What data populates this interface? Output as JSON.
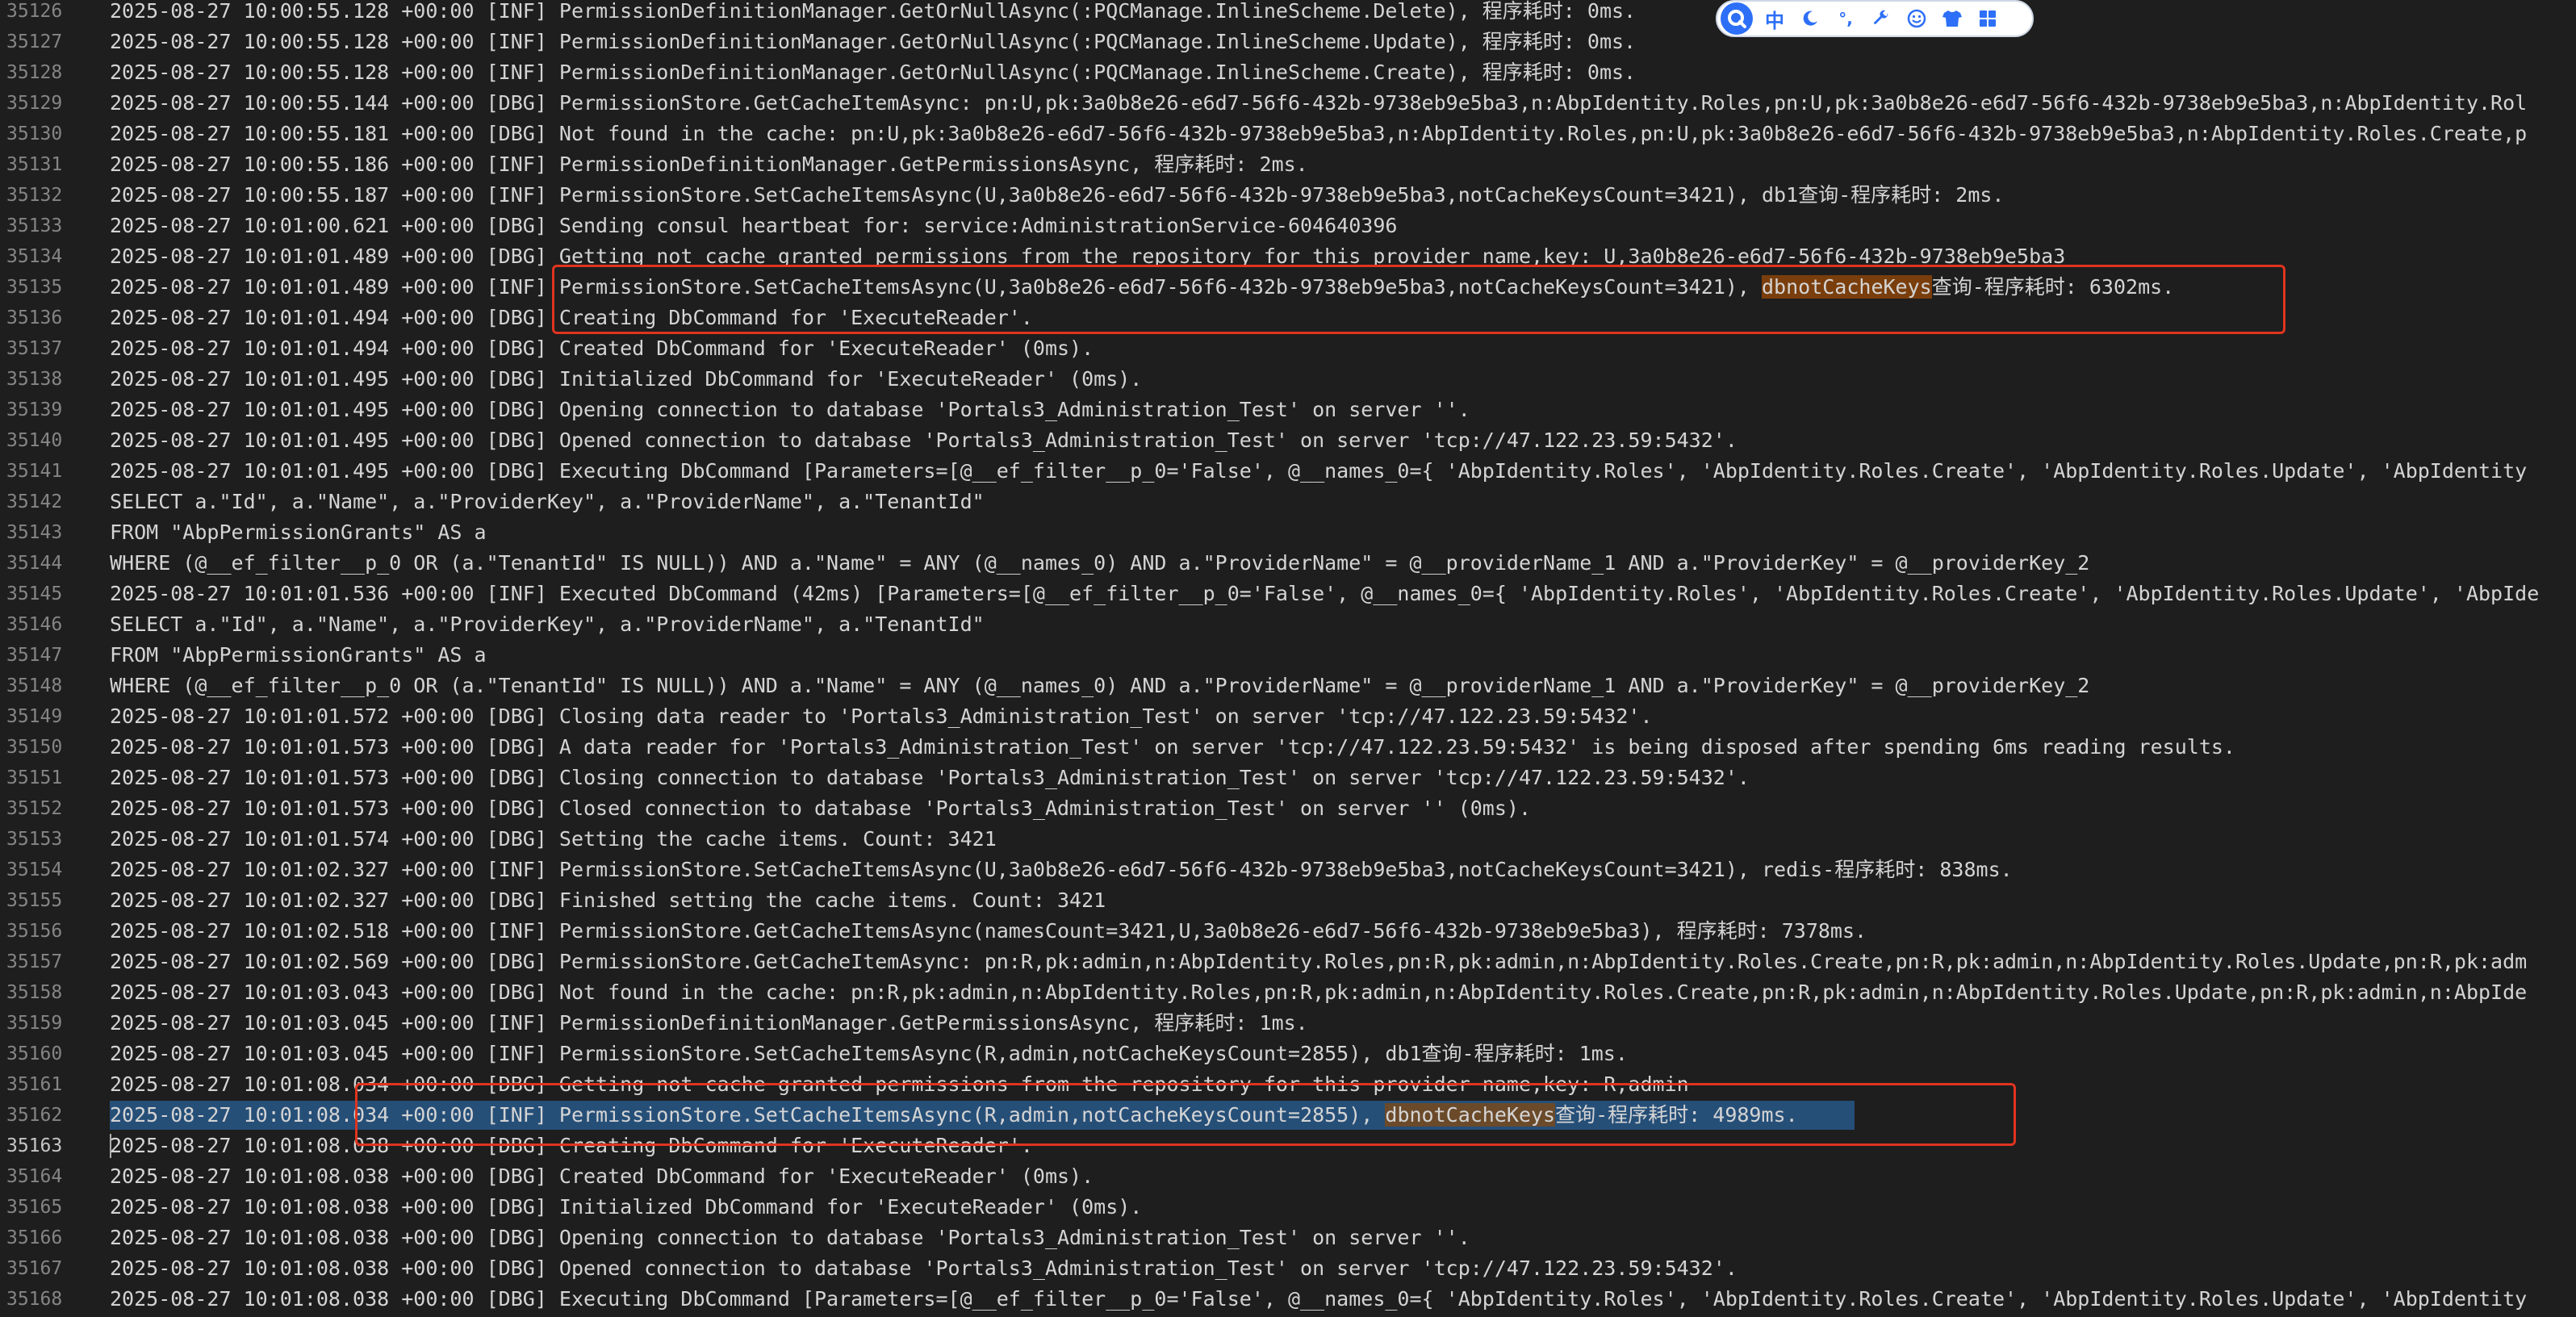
{
  "ime_toolbar": {
    "mode_label": "中",
    "punct_label": "°,",
    "icons": [
      "input-method-logo-icon",
      "moon-icon",
      "punctuation-icon",
      "wrench-icon",
      "smiley-icon",
      "shirt-icon",
      "grid-icon"
    ]
  },
  "colors": {
    "background": "#1e1e1e",
    "text": "#d4d4d4",
    "line_number": "#858585",
    "selection": "#264f78",
    "find_match": "#7a3e0c",
    "annotation_box": "#e0341f",
    "ime_accent": "#2d6ff7"
  },
  "highlighted_term": "dbnotCacheKeys",
  "current_line": "35163",
  "lines": [
    {
      "n": "35126",
      "text": "2025-08-27 10:00:55.128 +00:00 [INF] PermissionDefinitionManager.GetOrNullAsync(:PQCManage.InlineScheme.Delete), 程序耗时: 0ms."
    },
    {
      "n": "35127",
      "text": "2025-08-27 10:00:55.128 +00:00 [INF] PermissionDefinitionManager.GetOrNullAsync(:PQCManage.InlineScheme.Update), 程序耗时: 0ms."
    },
    {
      "n": "35128",
      "text": "2025-08-27 10:00:55.128 +00:00 [INF] PermissionDefinitionManager.GetOrNullAsync(:PQCManage.InlineScheme.Create), 程序耗时: 0ms."
    },
    {
      "n": "35129",
      "text": "2025-08-27 10:00:55.144 +00:00 [DBG] PermissionStore.GetCacheItemAsync: pn:U,pk:3a0b8e26-e6d7-56f6-432b-9738eb9e5ba3,n:AbpIdentity.Roles,pn:U,pk:3a0b8e26-e6d7-56f6-432b-9738eb9e5ba3,n:AbpIdentity.Rol"
    },
    {
      "n": "35130",
      "text": "2025-08-27 10:00:55.181 +00:00 [DBG] Not found in the cache: pn:U,pk:3a0b8e26-e6d7-56f6-432b-9738eb9e5ba3,n:AbpIdentity.Roles,pn:U,pk:3a0b8e26-e6d7-56f6-432b-9738eb9e5ba3,n:AbpIdentity.Roles.Create,p"
    },
    {
      "n": "35131",
      "text": "2025-08-27 10:00:55.186 +00:00 [INF] PermissionDefinitionManager.GetPermissionsAsync, 程序耗时: 2ms."
    },
    {
      "n": "35132",
      "text": "2025-08-27 10:00:55.187 +00:00 [INF] PermissionStore.SetCacheItemsAsync(U,3a0b8e26-e6d7-56f6-432b-9738eb9e5ba3,notCacheKeysCount=3421), db1查询-程序耗时: 2ms."
    },
    {
      "n": "35133",
      "text": "2025-08-27 10:01:00.621 +00:00 [DBG] Sending consul heartbeat for: service:AdministrationService-604640396"
    },
    {
      "n": "35134",
      "text": "2025-08-27 10:01:01.489 +00:00 [DBG] Getting not cache granted permissions from the repository for this provider name,key: U,3a0b8e26-e6d7-56f6-432b-9738eb9e5ba3"
    },
    {
      "n": "35135",
      "pre": "2025-08-27 10:01:01.489 +00:00 [INF] PermissionStore.SetCacheItemsAsync(U,3a0b8e26-e6d7-56f6-432b-9738eb9e5ba3,notCacheKeysCount=3421), ",
      "match": "dbnotCacheKeys",
      "post": "查询-程序耗时: 6302ms."
    },
    {
      "n": "35136",
      "text": "2025-08-27 10:01:01.494 +00:00 [DBG] Creating DbCommand for 'ExecuteReader'."
    },
    {
      "n": "35137",
      "text": "2025-08-27 10:01:01.494 +00:00 [DBG] Created DbCommand for 'ExecuteReader' (0ms)."
    },
    {
      "n": "35138",
      "text": "2025-08-27 10:01:01.495 +00:00 [DBG] Initialized DbCommand for 'ExecuteReader' (0ms)."
    },
    {
      "n": "35139",
      "text": "2025-08-27 10:01:01.495 +00:00 [DBG] Opening connection to database 'Portals3_Administration_Test' on server ''."
    },
    {
      "n": "35140",
      "text": "2025-08-27 10:01:01.495 +00:00 [DBG] Opened connection to database 'Portals3_Administration_Test' on server 'tcp://47.122.23.59:5432'."
    },
    {
      "n": "35141",
      "text": "2025-08-27 10:01:01.495 +00:00 [DBG] Executing DbCommand [Parameters=[@__ef_filter__p_0='False', @__names_0={ 'AbpIdentity.Roles', 'AbpIdentity.Roles.Create', 'AbpIdentity.Roles.Update', 'AbpIdentity"
    },
    {
      "n": "35142",
      "text": "SELECT a.\"Id\", a.\"Name\", a.\"ProviderKey\", a.\"ProviderName\", a.\"TenantId\""
    },
    {
      "n": "35143",
      "text": "FROM \"AbpPermissionGrants\" AS a"
    },
    {
      "n": "35144",
      "text": "WHERE (@__ef_filter__p_0 OR (a.\"TenantId\" IS NULL)) AND a.\"Name\" = ANY (@__names_0) AND a.\"ProviderName\" = @__providerName_1 AND a.\"ProviderKey\" = @__providerKey_2"
    },
    {
      "n": "35145",
      "text": "2025-08-27 10:01:01.536 +00:00 [INF] Executed DbCommand (42ms) [Parameters=[@__ef_filter__p_0='False', @__names_0={ 'AbpIdentity.Roles', 'AbpIdentity.Roles.Create', 'AbpIdentity.Roles.Update', 'AbpIde"
    },
    {
      "n": "35146",
      "text": "SELECT a.\"Id\", a.\"Name\", a.\"ProviderKey\", a.\"ProviderName\", a.\"TenantId\""
    },
    {
      "n": "35147",
      "text": "FROM \"AbpPermissionGrants\" AS a"
    },
    {
      "n": "35148",
      "text": "WHERE (@__ef_filter__p_0 OR (a.\"TenantId\" IS NULL)) AND a.\"Name\" = ANY (@__names_0) AND a.\"ProviderName\" = @__providerName_1 AND a.\"ProviderKey\" = @__providerKey_2"
    },
    {
      "n": "35149",
      "text": "2025-08-27 10:01:01.572 +00:00 [DBG] Closing data reader to 'Portals3_Administration_Test' on server 'tcp://47.122.23.59:5432'."
    },
    {
      "n": "35150",
      "text": "2025-08-27 10:01:01.573 +00:00 [DBG] A data reader for 'Portals3_Administration_Test' on server 'tcp://47.122.23.59:5432' is being disposed after spending 6ms reading results."
    },
    {
      "n": "35151",
      "text": "2025-08-27 10:01:01.573 +00:00 [DBG] Closing connection to database 'Portals3_Administration_Test' on server 'tcp://47.122.23.59:5432'."
    },
    {
      "n": "35152",
      "text": "2025-08-27 10:01:01.573 +00:00 [DBG] Closed connection to database 'Portals3_Administration_Test' on server '' (0ms)."
    },
    {
      "n": "35153",
      "text": "2025-08-27 10:01:01.574 +00:00 [DBG] Setting the cache items. Count: 3421"
    },
    {
      "n": "35154",
      "text": "2025-08-27 10:01:02.327 +00:00 [INF] PermissionStore.SetCacheItemsAsync(U,3a0b8e26-e6d7-56f6-432b-9738eb9e5ba3,notCacheKeysCount=3421), redis-程序耗时: 838ms."
    },
    {
      "n": "35155",
      "text": "2025-08-27 10:01:02.327 +00:00 [DBG] Finished setting the cache items. Count: 3421"
    },
    {
      "n": "35156",
      "text": "2025-08-27 10:01:02.518 +00:00 [INF] PermissionStore.GetCacheItemsAsync(namesCount=3421,U,3a0b8e26-e6d7-56f6-432b-9738eb9e5ba3), 程序耗时: 7378ms."
    },
    {
      "n": "35157",
      "text": "2025-08-27 10:01:02.569 +00:00 [DBG] PermissionStore.GetCacheItemAsync: pn:R,pk:admin,n:AbpIdentity.Roles,pn:R,pk:admin,n:AbpIdentity.Roles.Create,pn:R,pk:admin,n:AbpIdentity.Roles.Update,pn:R,pk:adm"
    },
    {
      "n": "35158",
      "text": "2025-08-27 10:01:03.043 +00:00 [DBG] Not found in the cache: pn:R,pk:admin,n:AbpIdentity.Roles,pn:R,pk:admin,n:AbpIdentity.Roles.Create,pn:R,pk:admin,n:AbpIdentity.Roles.Update,pn:R,pk:admin,n:AbpIde"
    },
    {
      "n": "35159",
      "text": "2025-08-27 10:01:03.045 +00:00 [INF] PermissionDefinitionManager.GetPermissionsAsync, 程序耗时: 1ms."
    },
    {
      "n": "35160",
      "text": "2025-08-27 10:01:03.045 +00:00 [INF] PermissionStore.SetCacheItemsAsync(R,admin,notCacheKeysCount=2855), db1查询-程序耗时: 1ms."
    },
    {
      "n": "35161",
      "text": "2025-08-27 10:01:08.034 +00:00 [DBG] Getting not cache granted permissions from the repository for this provider name,key: R,admin"
    },
    {
      "n": "35162",
      "pre": "2025-08-27 10:01:08.034 +00:00 [INF] PermissionStore.SetCacheItemsAsync(R,admin,notCacheKeysCount=2855), ",
      "match": "dbnotCacheKeys",
      "post": "查询-程序耗时: 4989ms.",
      "selected": true
    },
    {
      "n": "35163",
      "text": "2025-08-27 10:01:08.038 +00:00 [DBG] Creating DbCommand for 'ExecuteReader'.",
      "cursor": true
    },
    {
      "n": "35164",
      "text": "2025-08-27 10:01:08.038 +00:00 [DBG] Created DbCommand for 'ExecuteReader' (0ms)."
    },
    {
      "n": "35165",
      "text": "2025-08-27 10:01:08.038 +00:00 [DBG] Initialized DbCommand for 'ExecuteReader' (0ms)."
    },
    {
      "n": "35166",
      "text": "2025-08-27 10:01:08.038 +00:00 [DBG] Opening connection to database 'Portals3_Administration_Test' on server ''."
    },
    {
      "n": "35167",
      "text": "2025-08-27 10:01:08.038 +00:00 [DBG] Opened connection to database 'Portals3_Administration_Test' on server 'tcp://47.122.23.59:5432'."
    },
    {
      "n": "35168",
      "text": "2025-08-27 10:01:08.038 +00:00 [DBG] Executing DbCommand [Parameters=[@__ef_filter__p_0='False', @__names_0={ 'AbpIdentity.Roles', 'AbpIdentity.Roles.Create', 'AbpIdentity.Roles.Update', 'AbpIdentity"
    }
  ]
}
